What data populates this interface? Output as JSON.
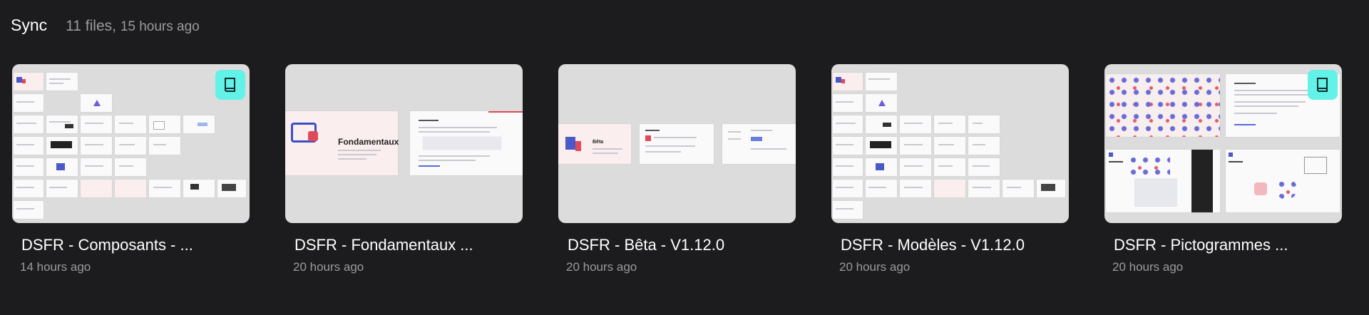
{
  "header": {
    "title": "Sync",
    "file_count": "11 files",
    "separator": ",",
    "updated": "15 hours ago"
  },
  "files": [
    {
      "name": "DSFR - Composants - ...",
      "date": "14 hours ago",
      "badge": "book-icon"
    },
    {
      "name": "DSFR - Fondamentaux ...",
      "date": "20 hours ago",
      "thumb_title": "Fondamentaux"
    },
    {
      "name": "DSFR - Bêta - V1.12.0",
      "date": "20 hours ago",
      "thumb_title": "Bêta"
    },
    {
      "name": "DSFR - Modèles - V1.12.0",
      "date": "20 hours ago"
    },
    {
      "name": "DSFR - Pictogrammes ...",
      "date": "20 hours ago",
      "badge": "book-icon"
    }
  ],
  "colors": {
    "background": "#1c1c1e",
    "badge": "#63f2e8",
    "thumb": "#dcdcdc",
    "muted_text": "#9a9aa0"
  }
}
